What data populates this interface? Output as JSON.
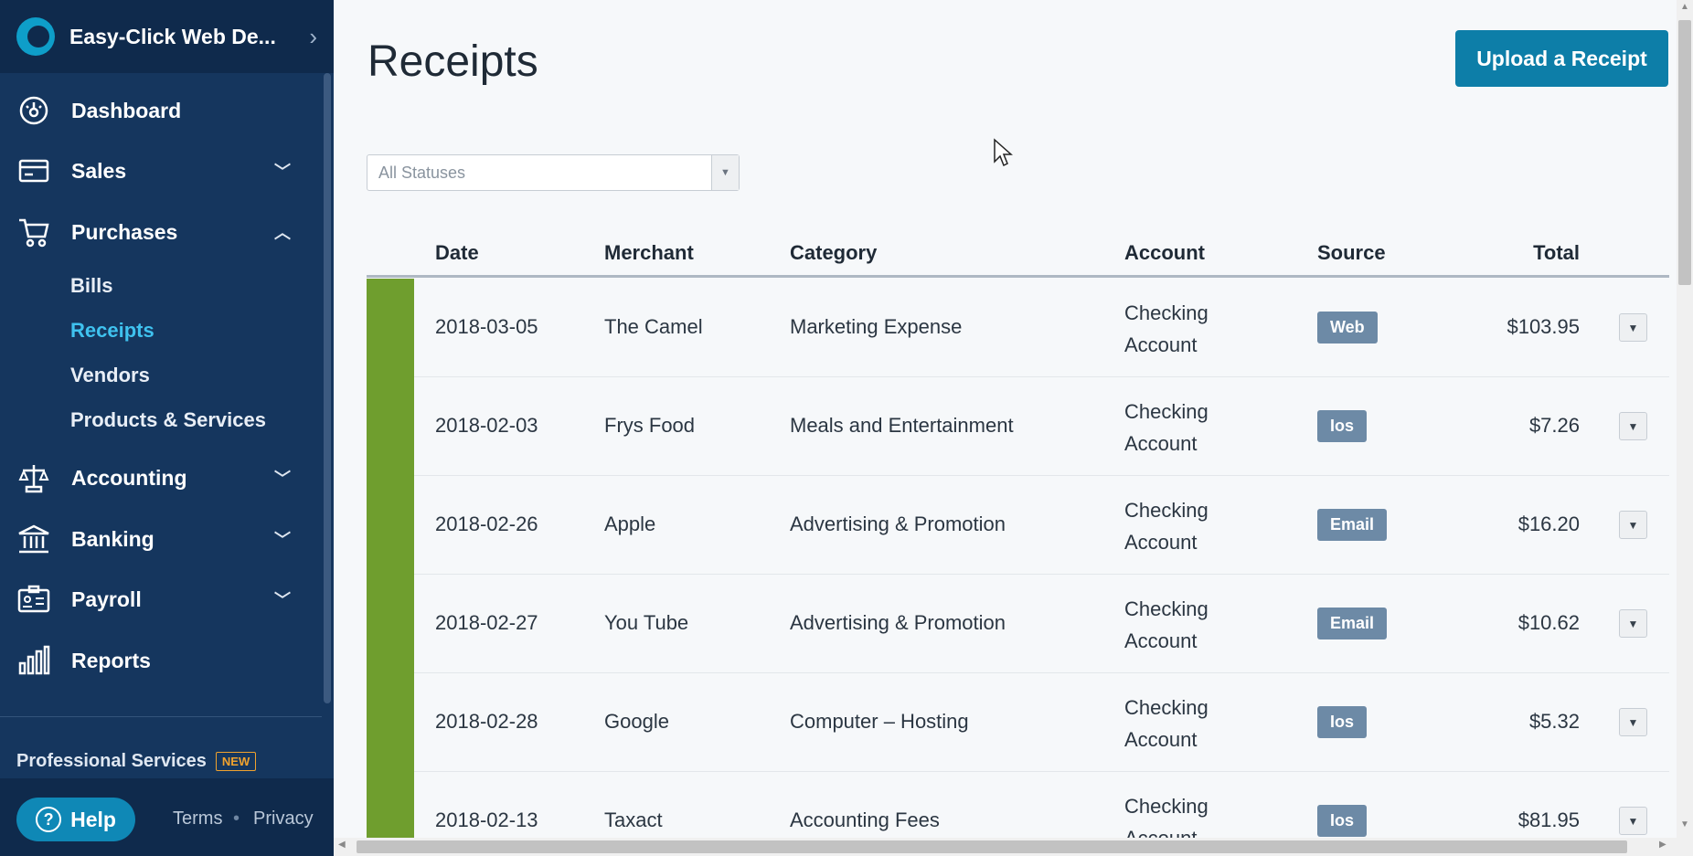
{
  "sidebar": {
    "company": "Easy-Click Web De...",
    "nav": [
      {
        "label": "Dashboard",
        "icon": "dashboard-icon"
      },
      {
        "label": "Sales",
        "icon": "sales-icon",
        "arrow": "chevron-down"
      },
      {
        "label": "Purchases",
        "icon": "cart-icon",
        "arrow": "chevron-up"
      },
      {
        "label": "Accounting",
        "icon": "scale-icon",
        "arrow": "chevron-down"
      },
      {
        "label": "Banking",
        "icon": "bank-icon",
        "arrow": "chevron-down"
      },
      {
        "label": "Payroll",
        "icon": "payroll-icon",
        "arrow": "chevron-down"
      },
      {
        "label": "Reports",
        "icon": "reports-icon"
      }
    ],
    "purchases_sub": [
      "Bills",
      "Receipts",
      "Vendors",
      "Products & Services"
    ],
    "active_sub": "Receipts",
    "professional_services": "Professional Services",
    "new_badge": "NEW",
    "help": "Help",
    "terms": "Terms",
    "separator": "•",
    "privacy": "Privacy"
  },
  "colors": {
    "sidebar": "#15365e",
    "accent": "#0d7ea8",
    "active_link": "#3fc2ef",
    "status_bar": "#6f9e2e",
    "badge": "#6d8aa6"
  },
  "page": {
    "title": "Receipts",
    "upload_button": "Upload a Receipt",
    "status_filter": "All Statuses"
  },
  "table": {
    "headers": {
      "date": "Date",
      "merchant": "Merchant",
      "category": "Category",
      "account": "Account",
      "source": "Source",
      "total": "Total"
    },
    "rows": [
      {
        "date": "2018-03-05",
        "merchant": "The Camel",
        "category": "Marketing Expense",
        "account_line1": "Checking",
        "account_line2": "Account",
        "source": "Web",
        "total": "$103.95"
      },
      {
        "date": "2018-02-03",
        "merchant": "Frys Food",
        "category": "Meals and Entertainment",
        "account_line1": "Checking",
        "account_line2": "Account",
        "source": "Ios",
        "total": "$7.26"
      },
      {
        "date": "2018-02-26",
        "merchant": "Apple",
        "category": "Advertising & Promotion",
        "account_line1": "Checking",
        "account_line2": "Account",
        "source": "Email",
        "total": "$16.20"
      },
      {
        "date": "2018-02-27",
        "merchant": "You Tube",
        "category": "Advertising & Promotion",
        "account_line1": "Checking",
        "account_line2": "Account",
        "source": "Email",
        "total": "$10.62"
      },
      {
        "date": "2018-02-28",
        "merchant": "Google",
        "category": "Computer – Hosting",
        "account_line1": "Checking",
        "account_line2": "Account",
        "source": "Ios",
        "total": "$5.32"
      },
      {
        "date": "2018-02-13",
        "merchant": "Taxact",
        "category": "Accounting Fees",
        "account_line1": "Checking",
        "account_line2": "Account",
        "source": "Ios",
        "total": "$81.95"
      }
    ]
  }
}
